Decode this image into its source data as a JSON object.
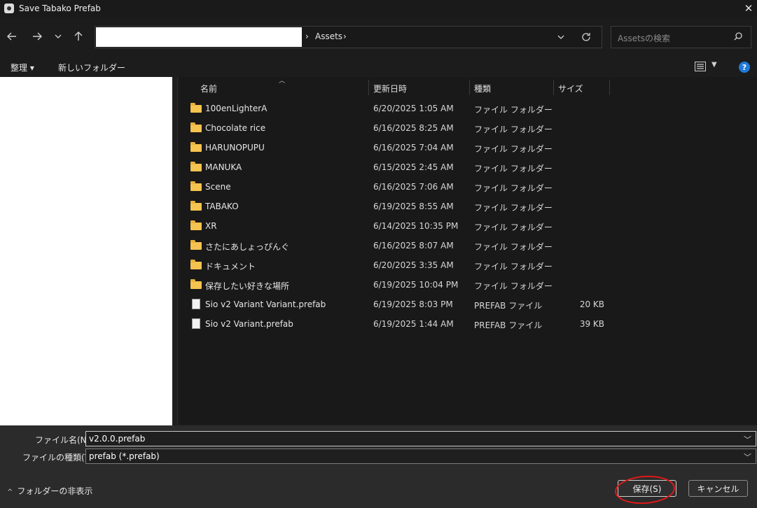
{
  "window": {
    "title": "Save Tabako Prefab",
    "close_glyph": "✕"
  },
  "nav": {
    "back_icon": "arrow-left-icon",
    "forward_icon": "arrow-right-icon",
    "recent_icon": "chevron-down-icon",
    "up_icon": "arrow-up-icon",
    "breadcrumb_sep": "›",
    "breadcrumb": [
      "Assets"
    ],
    "search_placeholder": "Assetsの検索"
  },
  "commands": {
    "organize": "整理 ▾",
    "new_folder": "新しいフォルダー",
    "help": "?"
  },
  "columns": {
    "name": "名前",
    "date": "更新日時",
    "type": "種類",
    "size": "サイズ"
  },
  "files": [
    {
      "name": "100enLighterA",
      "date": "6/20/2025 1:05 AM",
      "type": "ファイル フォルダー",
      "size": "",
      "kind": "folder"
    },
    {
      "name": "Chocolate rice",
      "date": "6/16/2025 8:25 AM",
      "type": "ファイル フォルダー",
      "size": "",
      "kind": "folder"
    },
    {
      "name": "HARUNOPUPU",
      "date": "6/16/2025 7:04 AM",
      "type": "ファイル フォルダー",
      "size": "",
      "kind": "folder"
    },
    {
      "name": "MANUKA",
      "date": "6/15/2025 2:45 AM",
      "type": "ファイル フォルダー",
      "size": "",
      "kind": "folder"
    },
    {
      "name": "Scene",
      "date": "6/16/2025 7:06 AM",
      "type": "ファイル フォルダー",
      "size": "",
      "kind": "folder"
    },
    {
      "name": "TABAKO",
      "date": "6/19/2025 8:55 AM",
      "type": "ファイル フォルダー",
      "size": "",
      "kind": "folder"
    },
    {
      "name": "XR",
      "date": "6/14/2025 10:35 PM",
      "type": "ファイル フォルダー",
      "size": "",
      "kind": "folder"
    },
    {
      "name": "さたにあしょっぴんぐ",
      "date": "6/16/2025 8:07 AM",
      "type": "ファイル フォルダー",
      "size": "",
      "kind": "folder"
    },
    {
      "name": "ドキュメント",
      "date": "6/20/2025 3:35 AM",
      "type": "ファイル フォルダー",
      "size": "",
      "kind": "folder"
    },
    {
      "name": "保存したい好きな場所",
      "date": "6/19/2025 10:04 PM",
      "type": "ファイル フォルダー",
      "size": "",
      "kind": "folder"
    },
    {
      "name": "Sio v2 Variant Variant.prefab",
      "date": "6/19/2025 8:03 PM",
      "type": "PREFAB ファイル",
      "size": "20 KB",
      "kind": "file"
    },
    {
      "name": "Sio v2 Variant.prefab",
      "date": "6/19/2025 1:44 AM",
      "type": "PREFAB ファイル",
      "size": "39 KB",
      "kind": "file"
    }
  ],
  "form": {
    "filename_label": "ファイル名(N):",
    "filename_value": "v2.0.0.prefab",
    "filetype_label": "ファイルの種類(T):",
    "filetype_value": "prefab (*.prefab)",
    "hide_folders": "フォルダーの非表示",
    "save": "保存(S)",
    "cancel": "キャンセル"
  },
  "colors": {
    "accent": "#1e7ad8",
    "folder": "#f5c350",
    "annotation": "#e01818"
  }
}
